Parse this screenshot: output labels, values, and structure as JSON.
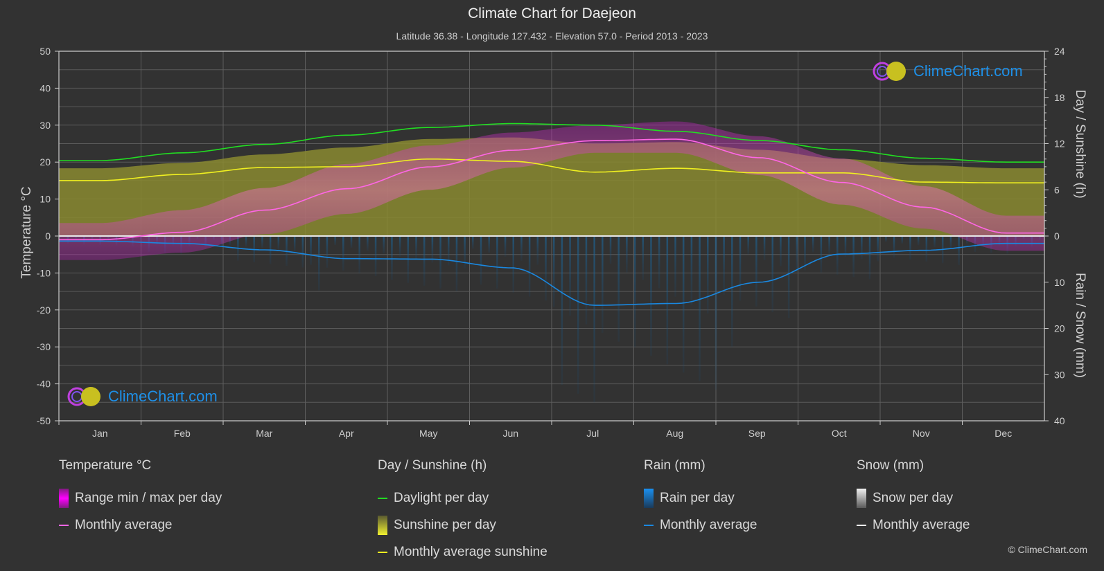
{
  "header": {
    "title": "Climate Chart for Daejeon",
    "subtitle": "Latitude 36.38 - Longitude 127.432 - Elevation 57.0 - Period 2013 - 2023"
  },
  "watermark": {
    "text": "ClimeChart.com"
  },
  "copyright": "© ClimeChart.com",
  "legend": {
    "groups": [
      {
        "title": "Temperature °C",
        "items": [
          {
            "label": "Range min / max per day",
            "kind": "bar",
            "color": "#e020e0"
          },
          {
            "label": "Monthly average",
            "kind": "line",
            "color": "#ff66e6"
          }
        ]
      },
      {
        "title": "Day / Sunshine (h)",
        "items": [
          {
            "label": "Daylight per day",
            "kind": "line",
            "color": "#22dd22"
          },
          {
            "label": "Sunshine per day",
            "kind": "bar",
            "color": "#e6e62a"
          },
          {
            "label": "Monthly average sunshine",
            "kind": "line",
            "color": "#f0f020"
          }
        ]
      },
      {
        "title": "Rain (mm)",
        "items": [
          {
            "label": "Rain per day",
            "kind": "bar",
            "color": "#1a88e0"
          },
          {
            "label": "Monthly average",
            "kind": "line",
            "color": "#1a88e0"
          }
        ]
      },
      {
        "title": "Snow (mm)",
        "items": [
          {
            "label": "Snow per day",
            "kind": "bar",
            "color": "#d8d8d8"
          },
          {
            "label": "Monthly average",
            "kind": "line",
            "color": "#eeeeee"
          }
        ]
      }
    ]
  },
  "chart_data": {
    "type": "line",
    "title": "Climate Chart for Daejeon",
    "subtitle": "Latitude 36.38 - Longitude 127.432 - Elevation 57.0 - Period 2013 - 2023",
    "categories": [
      "Jan",
      "Feb",
      "Mar",
      "Apr",
      "May",
      "Jun",
      "Jul",
      "Aug",
      "Sep",
      "Oct",
      "Nov",
      "Dec"
    ],
    "axes": {
      "left": {
        "label": "Temperature °C",
        "range": [
          -50,
          50
        ],
        "ticks": [
          50,
          40,
          30,
          20,
          10,
          0,
          -10,
          -20,
          -30,
          -40,
          -50
        ]
      },
      "right_top": {
        "label": "Day / Sunshine (h)",
        "range": [
          0,
          24
        ],
        "ticks": [
          24,
          18,
          12,
          6,
          0
        ]
      },
      "right_bottom": {
        "label": "Rain / Snow (mm)",
        "range": [
          0,
          40
        ],
        "ticks": [
          0,
          10,
          20,
          30,
          40
        ]
      }
    },
    "grid": true,
    "series": [
      {
        "name": "Temperature monthly average (°C)",
        "axis": "left",
        "color": "#ff66e6",
        "values": [
          -1.0,
          1.0,
          7.0,
          12.8,
          18.7,
          23.2,
          25.8,
          26.2,
          21.2,
          14.5,
          7.8,
          0.8
        ]
      },
      {
        "name": "Temperature daily max envelope (°C)",
        "axis": "left",
        "color": "#c020c0",
        "values": [
          3.5,
          7.0,
          13.0,
          19.5,
          24.5,
          28.0,
          30.0,
          31.0,
          27.0,
          21.0,
          13.5,
          5.5
        ]
      },
      {
        "name": "Temperature daily min envelope (°C)",
        "axis": "left",
        "color": "#c020c0",
        "values": [
          -6.5,
          -4.5,
          0.5,
          6.0,
          12.5,
          18.5,
          22.5,
          22.5,
          16.5,
          8.5,
          2.0,
          -4.0
        ]
      },
      {
        "name": "Daylight per day (h)",
        "axis": "right_top",
        "color": "#22dd22",
        "values": [
          9.8,
          10.8,
          11.9,
          13.1,
          14.1,
          14.6,
          14.4,
          13.6,
          12.4,
          11.2,
          10.1,
          9.6
        ]
      },
      {
        "name": "Sunshine per day (h, envelope)",
        "axis": "right_top",
        "color": "#8a8a30",
        "values": [
          8.8,
          9.5,
          10.6,
          11.5,
          12.6,
          12.8,
          12.0,
          12.2,
          11.2,
          10.0,
          9.2,
          8.8
        ]
      },
      {
        "name": "Monthly average sunshine (h)",
        "axis": "right_top",
        "color": "#f0f020",
        "values": [
          7.2,
          8.0,
          8.9,
          9.0,
          10.0,
          9.7,
          8.3,
          8.8,
          8.2,
          8.2,
          7.0,
          6.9
        ]
      },
      {
        "name": "Rain monthly average (mm/day)",
        "axis": "right_bottom",
        "color": "#1a88e0",
        "values": [
          1.1,
          1.6,
          3.0,
          4.9,
          5.0,
          6.9,
          15.0,
          14.6,
          10.0,
          3.9,
          3.1,
          1.6
        ]
      },
      {
        "name": "Snow monthly average (mm/day)",
        "axis": "right_bottom",
        "color": "#eeeeee",
        "values": [
          0.5,
          0.3,
          0.1,
          0,
          0,
          0,
          0,
          0,
          0,
          0,
          0.1,
          0.4
        ]
      }
    ]
  }
}
